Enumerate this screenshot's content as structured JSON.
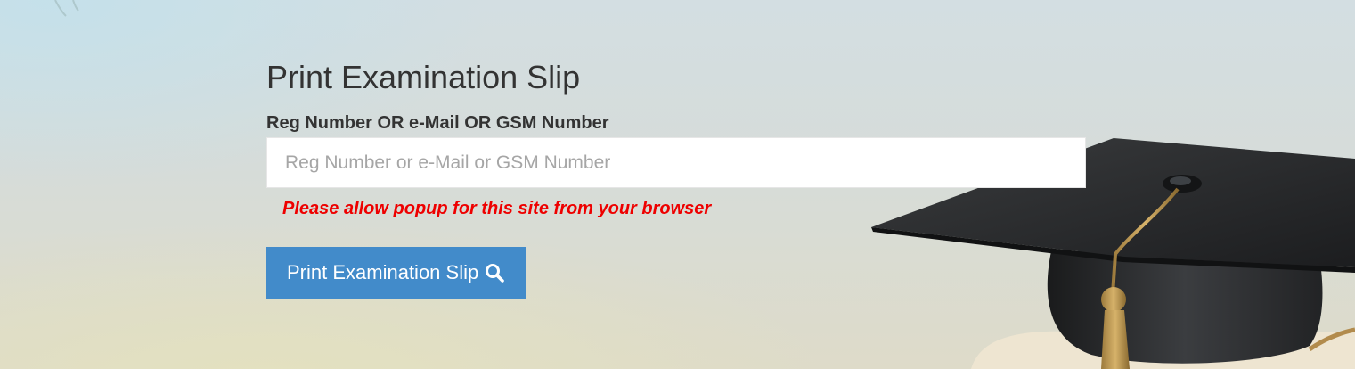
{
  "page": {
    "title": "Print Examination Slip"
  },
  "form": {
    "label": "Reg Number OR e-Mail OR GSM Number",
    "input_placeholder": "Reg Number or e-Mail or GSM Number",
    "input_value": "",
    "warning": "Please allow popup for this site from your browser",
    "button_label": "Print Examination Slip",
    "button_icon": "search-icon"
  },
  "background": {
    "illustration": "graduation-cap-icon"
  },
  "colors": {
    "button": "#428bca",
    "warning": "#ee0000",
    "title": "#333333"
  }
}
